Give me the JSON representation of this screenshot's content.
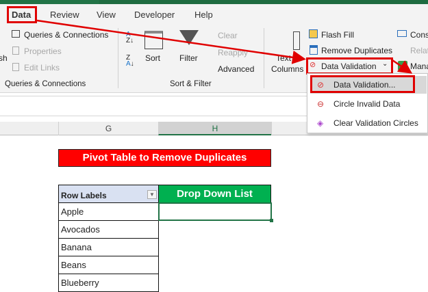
{
  "tabs": [
    "Data",
    "Review",
    "View",
    "Developer",
    "Help"
  ],
  "ribbon": {
    "refresh_partial": "sh",
    "queries": [
      "Queries & Connections",
      "Properties",
      "Edit Links"
    ],
    "queries_group": "Queries & Connections",
    "sort_label": "Sort",
    "filter_label": "Filter",
    "filter_items": [
      "Clear",
      "Reapply",
      "Advanced"
    ],
    "sort_group": "Sort & Filter",
    "text_to_columns": [
      "Text to",
      "Columns"
    ],
    "data_tools": [
      "Flash Fill",
      "Remove Duplicates",
      "Data Validation"
    ],
    "right_items": [
      "Cons",
      "Relat",
      "Mana"
    ]
  },
  "menu": [
    "Data Validation...",
    "Circle Invalid Data",
    "Clear Validation Circles"
  ],
  "columns": [
    "G",
    "H"
  ],
  "sheet": {
    "title": "Pivot Table to Remove Duplicates",
    "row_labels_header": "Row Labels",
    "dropdown_header": "Drop Down List",
    "rows": [
      "Apple",
      "Avocados",
      "Banana",
      "Beans",
      "Blueberry"
    ]
  },
  "colors": {
    "accent": "#217346",
    "highlight": "#e00000",
    "title_bg": "#ff0000",
    "header_green": "#00b050"
  }
}
